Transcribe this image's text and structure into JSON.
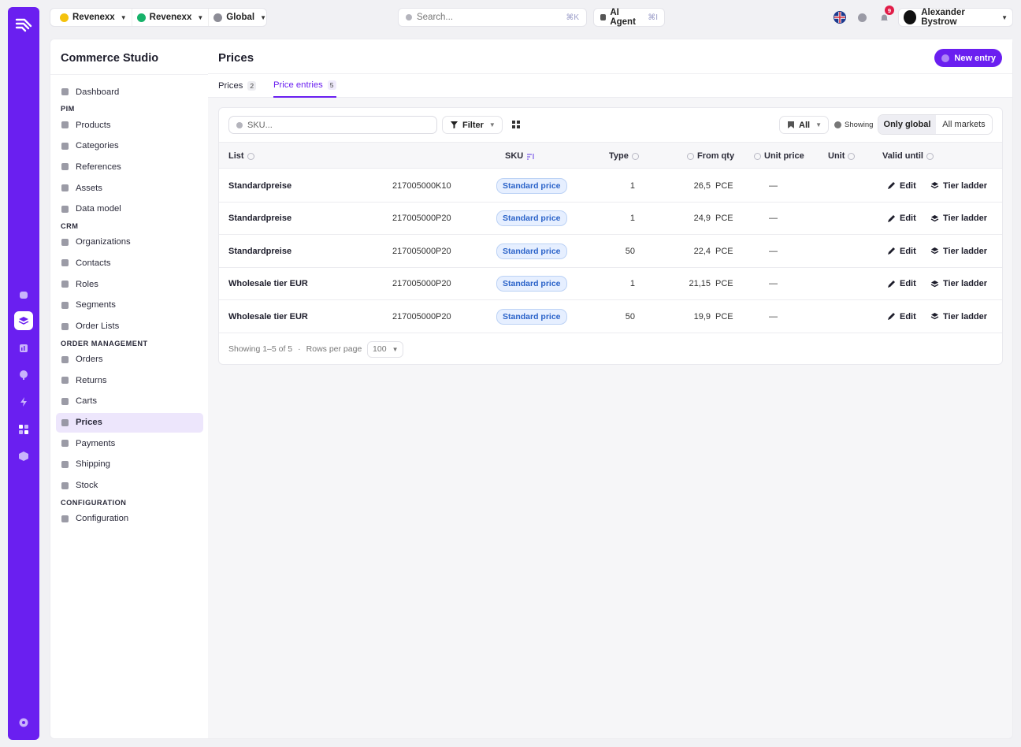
{
  "topbar": {
    "org": "Revenexx",
    "store": "Revenexx",
    "scope": "Global",
    "search_placeholder": "Search...",
    "search_shortcut": "⌘K",
    "ai_agent": "AI Agent",
    "ai_shortcut": "⌘I",
    "notifications_count": "9",
    "user_name": "Alexander Bystrow"
  },
  "sidebar": {
    "title": "Commerce Studio",
    "dashboard": "Dashboard",
    "sections": [
      {
        "label": "PIM",
        "items": [
          "Products",
          "Categories",
          "References",
          "Assets",
          "Data model"
        ]
      },
      {
        "label": "CRM",
        "items": [
          "Organizations",
          "Contacts",
          "Roles",
          "Segments",
          "Order Lists"
        ]
      },
      {
        "label": "ORDER MANAGEMENT",
        "items": [
          "Orders",
          "Returns",
          "Carts",
          "Prices",
          "Payments",
          "Shipping",
          "Stock"
        ]
      },
      {
        "label": "CONFIGURATION",
        "items": [
          "Configuration"
        ]
      }
    ],
    "active_item": "Prices"
  },
  "page": {
    "title": "Prices",
    "new_button": "New entry",
    "tabs": [
      {
        "label": "Prices",
        "count": "2"
      },
      {
        "label": "Price entries",
        "count": "5"
      }
    ]
  },
  "toolbar": {
    "sku_placeholder": "SKU...",
    "filter": "Filter",
    "all": "All",
    "showing": "Showing",
    "only_global": "Only global",
    "all_markets": "All markets"
  },
  "table": {
    "headers": {
      "list": "List",
      "sku": "SKU",
      "type": "Type",
      "from_qty": "From qty",
      "unit_price": "Unit price",
      "unit": "Unit",
      "valid_until": "Valid until"
    },
    "rows": [
      {
        "list": "Standardpreise",
        "sku": "217005000K10",
        "type": "Standard price",
        "from_qty": "1",
        "price": "26,5",
        "unit": "PCE",
        "valid_until": "—"
      },
      {
        "list": "Standardpreise",
        "sku": "217005000P20",
        "type": "Standard price",
        "from_qty": "1",
        "price": "24,9",
        "unit": "PCE",
        "valid_until": "—"
      },
      {
        "list": "Standardpreise",
        "sku": "217005000P20",
        "type": "Standard price",
        "from_qty": "50",
        "price": "22,4",
        "unit": "PCE",
        "valid_until": "—"
      },
      {
        "list": "Wholesale tier EUR",
        "sku": "217005000P20",
        "type": "Standard price",
        "from_qty": "1",
        "price": "21,15",
        "unit": "PCE",
        "valid_until": "—"
      },
      {
        "list": "Wholesale tier EUR",
        "sku": "217005000P20",
        "type": "Standard price",
        "from_qty": "50",
        "price": "19,9",
        "unit": "PCE",
        "valid_until": "—"
      }
    ],
    "edit_label": "Edit",
    "tier_label": "Tier ladder"
  },
  "footer": {
    "showing": "Showing 1–5 of 5",
    "separator": "·",
    "rows_per_page": "Rows per page",
    "rows_value": "100"
  },
  "colors": {
    "accent": "#6a1ff0",
    "pill_text": "#2b63c9",
    "pill_bg": "#e6efff"
  }
}
